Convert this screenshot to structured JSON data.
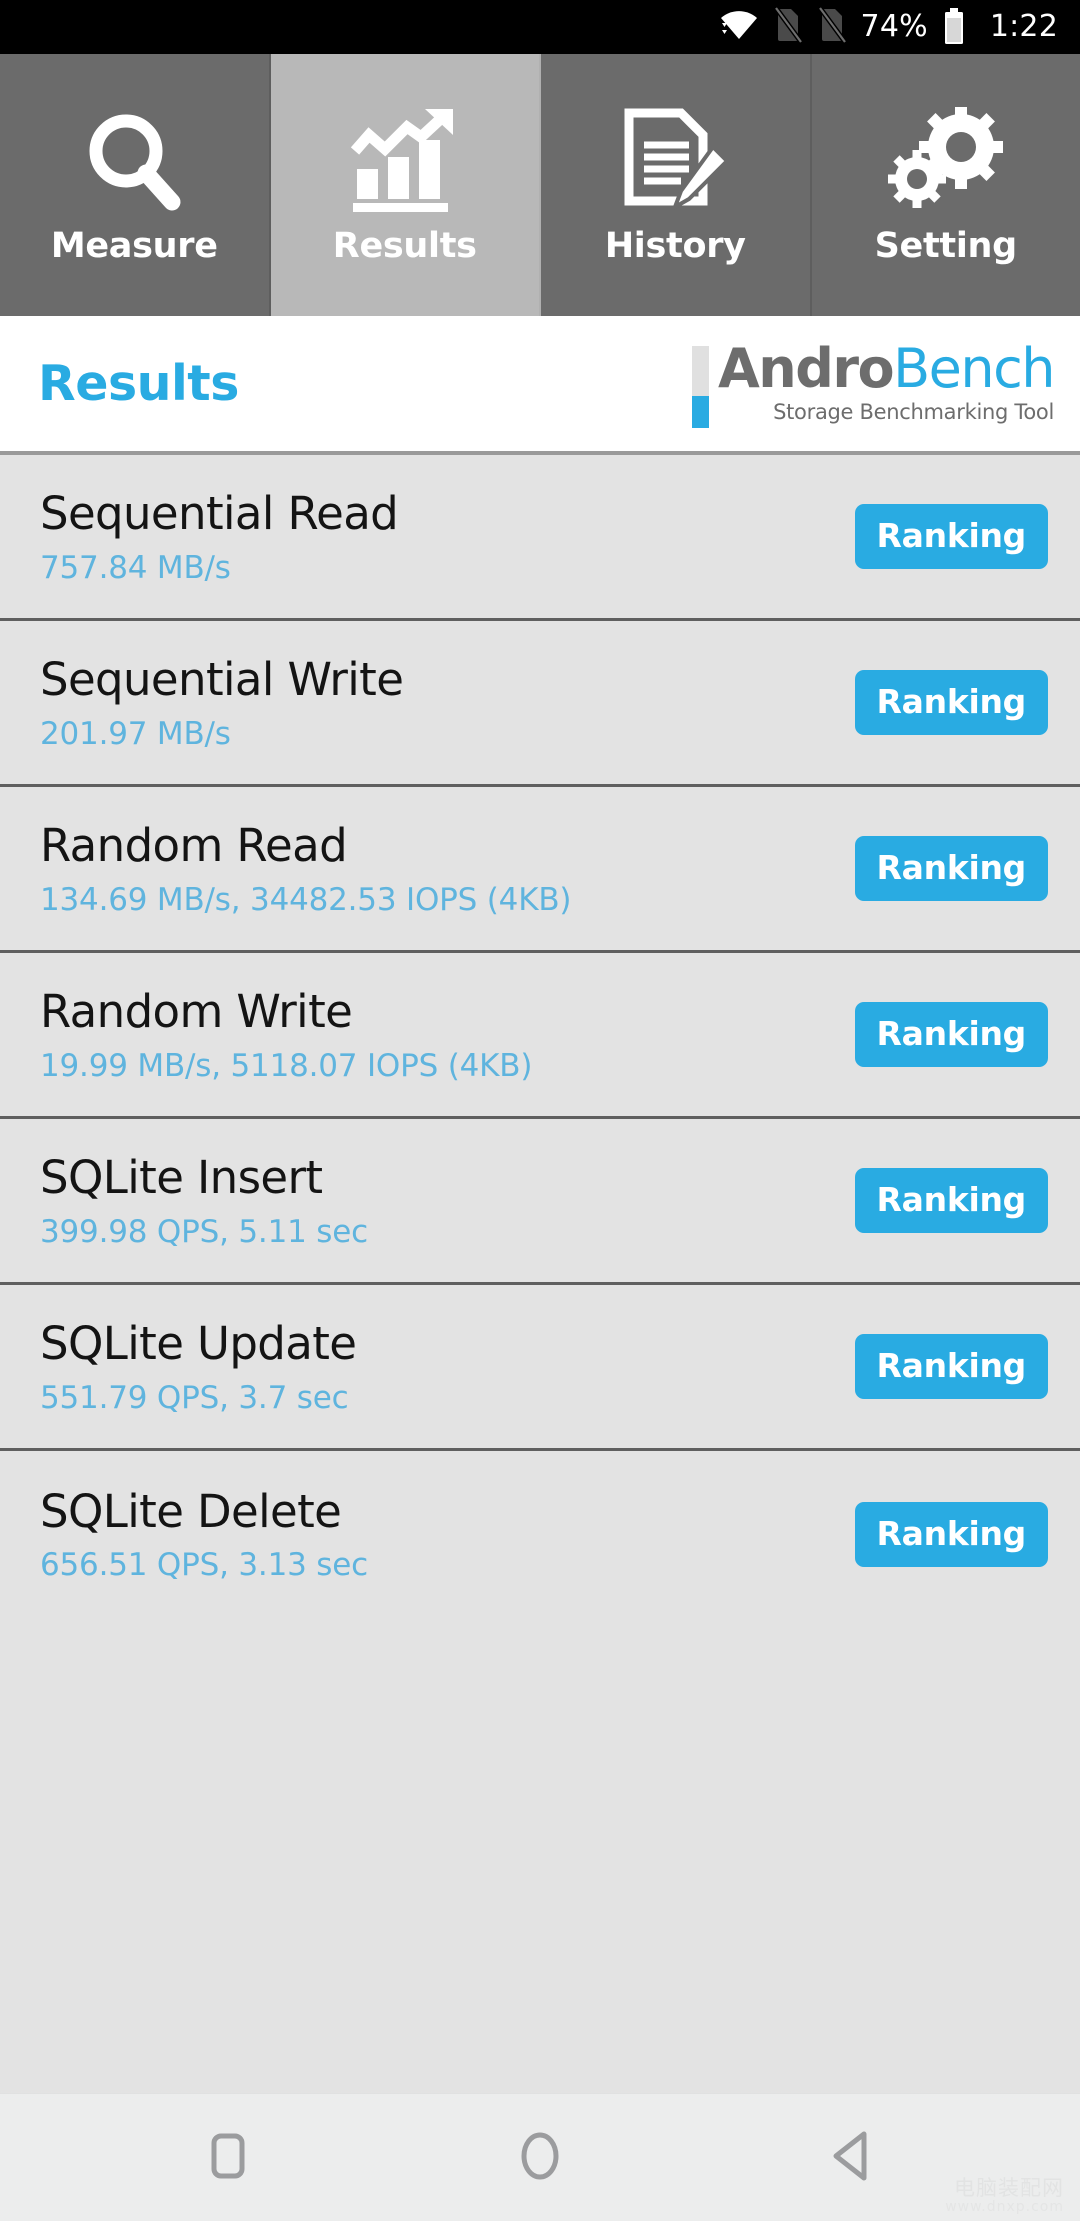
{
  "status_bar": {
    "wifi_icon": "wifi-icon",
    "sim1_icon": "no-sim-icon",
    "sim2_icon": "no-sim-icon",
    "battery_percent": "74%",
    "battery_icon": "battery-icon",
    "time": "1:22"
  },
  "tabs": [
    {
      "label": "Measure",
      "icon": "magnifier-icon",
      "active": false
    },
    {
      "label": "Results",
      "icon": "bar-chart-trend-icon",
      "active": true
    },
    {
      "label": "History",
      "icon": "document-pencil-icon",
      "active": false
    },
    {
      "label": "Setting",
      "icon": "gears-icon",
      "active": false
    }
  ],
  "header": {
    "title": "Results",
    "logo_primary": "Andro",
    "logo_secondary": "Bench",
    "logo_subtitle": "Storage Benchmarking Tool"
  },
  "results": {
    "ranking_label": "Ranking",
    "rows": [
      {
        "name": "Sequential Read",
        "value": "757.84 MB/s"
      },
      {
        "name": "Sequential Write",
        "value": "201.97 MB/s"
      },
      {
        "name": "Random Read",
        "value": "134.69 MB/s, 34482.53 IOPS (4KB)"
      },
      {
        "name": "Random Write",
        "value": "19.99 MB/s, 5118.07 IOPS (4KB)"
      },
      {
        "name": "SQLite Insert",
        "value": "399.98 QPS, 5.11 sec"
      },
      {
        "name": "SQLite Update",
        "value": "551.79 QPS, 3.7 sec"
      },
      {
        "name": "SQLite Delete",
        "value": "656.51 QPS, 3.13 sec"
      }
    ]
  },
  "nav_bar": {
    "recents_icon": "square-icon",
    "home_icon": "circle-icon",
    "back_icon": "triangle-left-icon"
  },
  "watermark": {
    "main": "电脑装配网",
    "sub": "www.dnxp.com"
  },
  "colors": {
    "accent_blue": "#29abe2",
    "value_blue": "#5fb4de",
    "tab_inactive": "#6b6b6b",
    "tab_active": "#b8b8b8",
    "list_bg": "#e3e3e3",
    "nav_bg": "#eceded"
  }
}
